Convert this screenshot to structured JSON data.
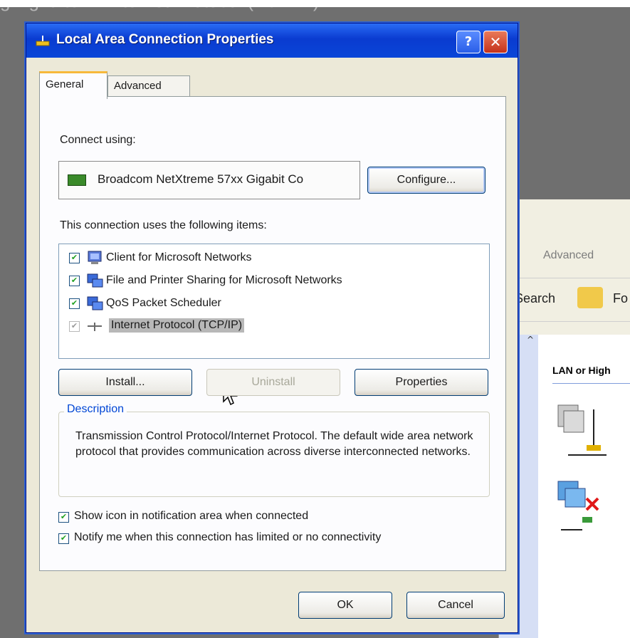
{
  "caption": "ghlight item \"Internet Protocol (TCP/IP)\".",
  "dialog": {
    "title": "Local Area Connection Properties",
    "help_glyph": "?",
    "close_glyph": "✕",
    "tabs": [
      {
        "label": "General",
        "active": true
      },
      {
        "label": "Advanced",
        "active": false
      }
    ],
    "connect_using_label": "Connect using:",
    "adapter_name": "Broadcom NetXtreme 57xx Gigabit Co",
    "configure_label": "Configure...",
    "items_label": "This connection uses the following items:",
    "items": [
      {
        "label": "Client for Microsoft Networks",
        "checked": true,
        "icon": "client-icon"
      },
      {
        "label": "File and Printer Sharing for Microsoft Networks",
        "checked": true,
        "icon": "sharing-icon"
      },
      {
        "label": "QoS Packet Scheduler",
        "checked": true,
        "icon": "qos-icon"
      },
      {
        "label": "Internet Protocol (TCP/IP)",
        "checked": true,
        "icon": "protocol-icon",
        "selected": true
      }
    ],
    "install_label": "Install...",
    "uninstall_label": "Uninstall",
    "properties_label": "Properties",
    "description_legend": "Description",
    "description_text": "Transmission Control Protocol/Internet Protocol. The default wide area network protocol that provides communication across diverse interconnected networks.",
    "show_icon_label": "Show icon in notification area when connected",
    "notify_label": "Notify me when this connection has limited or no connectivity",
    "ok_label": "OK",
    "cancel_label": "Cancel"
  },
  "background_window": {
    "menu_item": "Advanced",
    "search_label": "Search",
    "folders_label": "Fo",
    "group_title": "LAN or High",
    "collapse_glyph": "^"
  },
  "colors": {
    "title_blue": "#0a46d8",
    "dialog_face": "#ece9d8",
    "check_green": "#21a121",
    "selection_gray": "#b8b8b8",
    "legend_blue": "#0046d5"
  }
}
